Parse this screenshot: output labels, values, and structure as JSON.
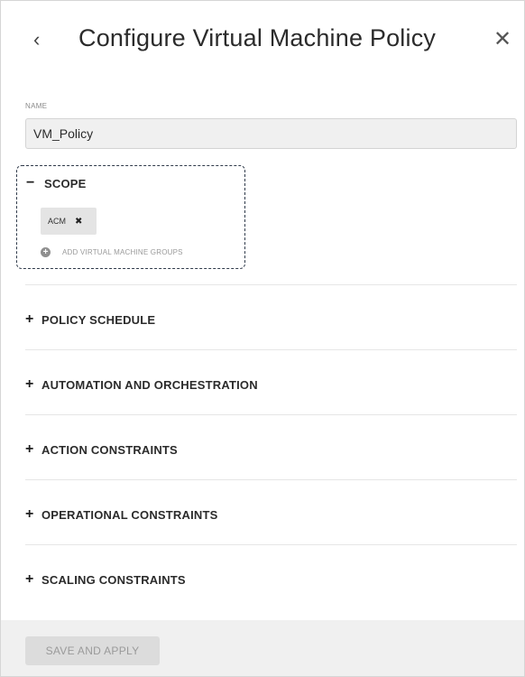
{
  "header": {
    "title": "Configure Virtual Machine Policy",
    "back_icon": "chevron-left-icon",
    "close_icon": "close-icon"
  },
  "name_field": {
    "label": "NAME",
    "value": "VM_Policy"
  },
  "scope": {
    "sign": "−",
    "label": "SCOPE",
    "chips": [
      {
        "label": "ACM",
        "remove": "✖"
      }
    ],
    "add_label": "ADD VIRTUAL MACHINE GROUPS"
  },
  "sections": [
    {
      "sign": "+",
      "label": "POLICY SCHEDULE"
    },
    {
      "sign": "+",
      "label": "AUTOMATION AND ORCHESTRATION"
    },
    {
      "sign": "+",
      "label": "ACTION CONSTRAINTS"
    },
    {
      "sign": "+",
      "label": "OPERATIONAL CONSTRAINTS"
    },
    {
      "sign": "+",
      "label": "SCALING CONSTRAINTS"
    }
  ],
  "footer": {
    "save_label": "SAVE AND APPLY"
  }
}
